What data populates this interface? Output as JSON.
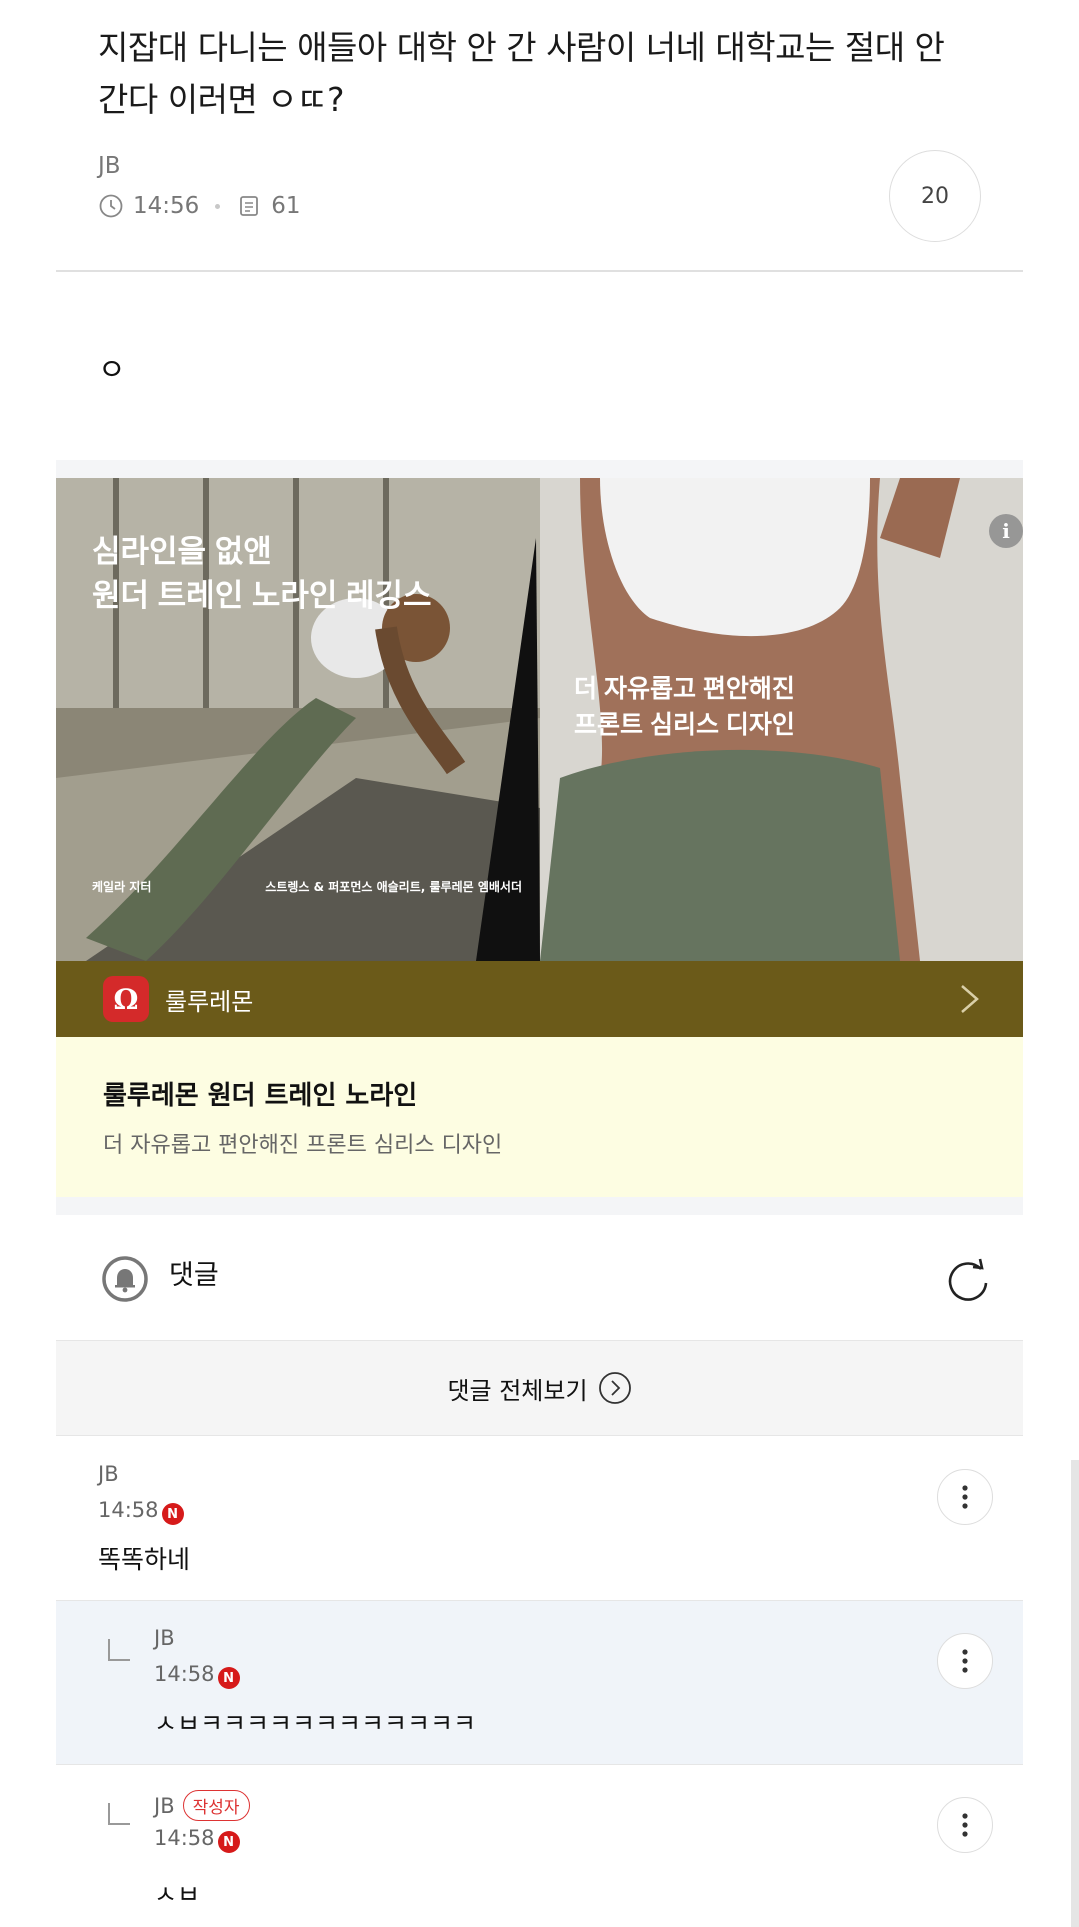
{
  "post": {
    "title": "지잡대 다니는 애들아 대학 안 간 사람이 너네 대학교는 절대 안 간다 이러면 ㅇㄸ?",
    "author": "JB",
    "time": "14:56",
    "views": "61",
    "comment_count": "20",
    "body": "ㅇ"
  },
  "ad": {
    "headline_line1": "심라인을 없앤",
    "headline_line2": "원더 트레인 노라인 레깅스",
    "sub_line1": "더 자유롭고 편안해진",
    "sub_line2": "프론트 심리스 디자인",
    "caption_left": "케일라 지터",
    "caption_right": "스트렝스 & 퍼포먼스 애슬리트, 룰루레몬 엠배서더",
    "info_icon": "i",
    "brand_name": "룰루레몬",
    "brand_logo_glyph": "Ω",
    "title": "룰루레몬 원더 트레인 노라인",
    "description": "더 자유롭고 편안해진 프론트 심리스 디자인",
    "brand_color": "#6b5a19",
    "panel_color": "#fdfde2"
  },
  "comments_section": {
    "label": "댓글",
    "view_all_label": "댓글 전체보기"
  },
  "comments": [
    {
      "author": "JB",
      "time": "14:58",
      "new_badge": "N",
      "text": "똑똑하네"
    },
    {
      "author": "JB",
      "time": "14:58",
      "new_badge": "N",
      "text": "ㅅㅂㅋㅋㅋㅋㅋㅋㅋㅋㅋㅋㅋㅋ"
    },
    {
      "author": "JB",
      "op_badge": "작성자",
      "time": "14:58",
      "new_badge": "N",
      "text": "ㅅㅂ"
    }
  ]
}
